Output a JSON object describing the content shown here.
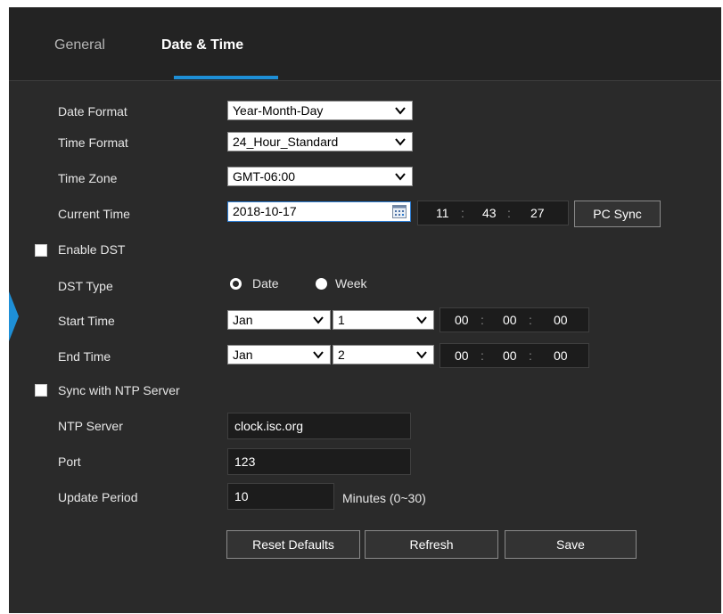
{
  "tabs": [
    {
      "label": "General"
    },
    {
      "label": "Date & Time"
    }
  ],
  "fields": {
    "date_format": {
      "label": "Date Format",
      "value": "Year-Month-Day"
    },
    "time_format": {
      "label": "Time Format",
      "value": "24_Hour_Standard"
    },
    "time_zone": {
      "label": "Time Zone",
      "value": "GMT-06:00"
    },
    "current_time": {
      "label": "Current Time",
      "date": "2018-10-17",
      "hour": "11",
      "minute": "43",
      "second": "27",
      "sync_label": "PC Sync"
    },
    "enable_dst": {
      "label": "Enable DST",
      "checked": false
    },
    "dst_type": {
      "label": "DST Type",
      "option_date": "Date",
      "option_week": "Week",
      "selected": "Date"
    },
    "start_time": {
      "label": "Start Time",
      "month": "Jan",
      "day": "1",
      "hour": "00",
      "minute": "00",
      "second": "00"
    },
    "end_time": {
      "label": "End Time",
      "month": "Jan",
      "day": "2",
      "hour": "00",
      "minute": "00",
      "second": "00"
    },
    "sync_ntp": {
      "label": "Sync with NTP Server",
      "checked": false
    },
    "ntp_server": {
      "label": "NTP Server",
      "value": "clock.isc.org"
    },
    "port": {
      "label": "Port",
      "value": "123"
    },
    "update_period": {
      "label": "Update Period",
      "value": "10",
      "unit": "Minutes (0~30)"
    }
  },
  "time_separator": ":",
  "buttons": {
    "reset": "Reset Defaults",
    "refresh": "Refresh",
    "save": "Save"
  },
  "colors": {
    "accent": "#1e8fd6",
    "panel_bg": "#2a2a2a",
    "header_bg": "#232323"
  }
}
